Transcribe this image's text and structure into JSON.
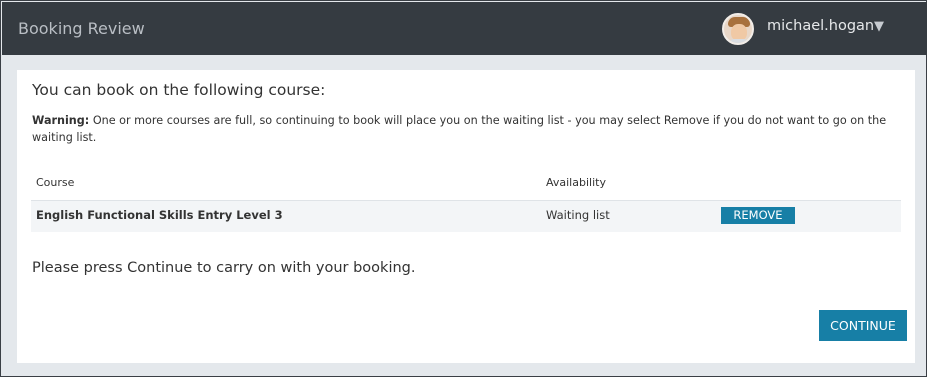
{
  "header": {
    "title": "Booking Review",
    "user": {
      "name": "michael.hogan",
      "caret": "▼",
      "avatar_icon": "user-avatar"
    }
  },
  "content": {
    "intro": "You can book on the following course:",
    "warning_label": "Warning:",
    "warning_text": " One or more courses are full, so continuing to book will place you on the waiting list - you may select Remove if you do not want to go on the waiting list.",
    "table": {
      "headers": {
        "course": "Course",
        "availability": "Availability"
      },
      "rows": [
        {
          "course": "English Functional Skills Entry Level 3",
          "availability": "Waiting list",
          "action": "REMOVE"
        }
      ]
    },
    "continue_note": "Please press Continue to carry on with your booking.",
    "continue_label": "CONTINUE"
  },
  "colors": {
    "header_bg": "#353b41",
    "accent": "#177fa6",
    "page_bg": "#e4e8ec"
  }
}
